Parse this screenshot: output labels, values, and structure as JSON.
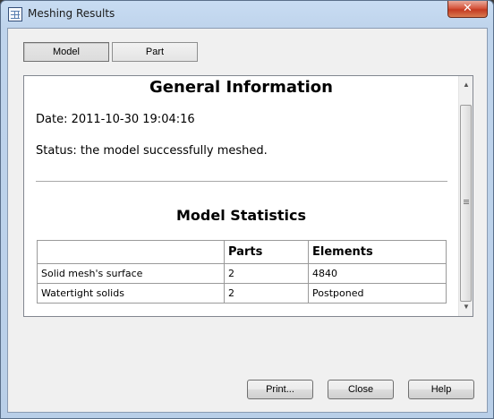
{
  "window": {
    "title": "Meshing Results",
    "close_glyph": "✕",
    "app_icon": "table-window-icon"
  },
  "tabs": [
    {
      "label": "Model",
      "active": true
    },
    {
      "label": "Part",
      "active": false
    }
  ],
  "report": {
    "heading": "General Information",
    "date_line": "Date: 2011-10-30 19:04:16",
    "status_line": "Status: the model successfully meshed.",
    "stats_heading": "Model Statistics",
    "table": {
      "headers": [
        "",
        "Parts",
        "Elements"
      ],
      "rows": [
        [
          "Solid mesh's surface",
          "2",
          "4840"
        ],
        [
          "Watertight solids",
          "2",
          "Postponed"
        ]
      ]
    }
  },
  "scrollbar": {
    "up_glyph": "▲",
    "down_glyph": "▼"
  },
  "buttons": {
    "print": "Print...",
    "close": "Close",
    "help": "Help"
  }
}
